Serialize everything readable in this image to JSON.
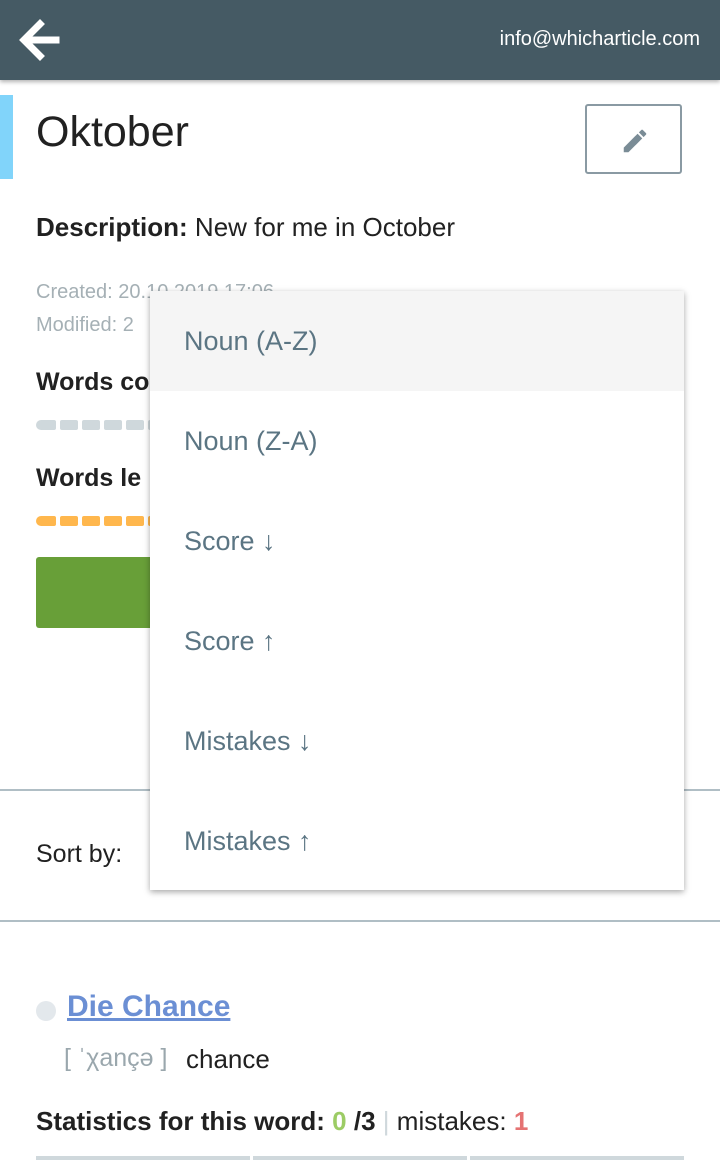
{
  "header": {
    "back_icon": "arrow-left-icon",
    "email": "info@whicharticle.com"
  },
  "list": {
    "title": "Oktober",
    "edit_icon": "pencil-icon",
    "description_label": "Description:",
    "description_value": " New for me in October",
    "created": "Created: 20.10.2019 17:06",
    "modified": "Modified: 2"
  },
  "sections": {
    "words_correct_label": "Words co",
    "words_left_label": "Words le"
  },
  "sort": {
    "label": "Sort by:",
    "options": [
      {
        "label": "Noun (A-Z)",
        "selected": true
      },
      {
        "label": "Noun (Z-A)",
        "selected": false
      },
      {
        "label": "Score ↓",
        "selected": false
      },
      {
        "label": "Score ↑",
        "selected": false
      },
      {
        "label": "Mistakes ↓",
        "selected": false
      },
      {
        "label": "Mistakes ↑",
        "selected": false
      }
    ]
  },
  "word": {
    "noun": "Die Chance",
    "pronunciation": "[ ˈχançə ]",
    "translation": "chance",
    "stats_label": "Statistics for this word:",
    "correct": "0",
    "total": "/3",
    "separator": "|",
    "mistakes_label": "mistakes:",
    "mistakes": "1"
  },
  "colors": {
    "topbar": "#455a64",
    "accent": "#81d4fa",
    "progress_grey": "#cfd8dc",
    "progress_orange": "#ffb74d",
    "button_green": "#689f38",
    "link_blue": "#6b8fd4",
    "correct_green": "#9ccc65",
    "mistake_red": "#e57373"
  }
}
